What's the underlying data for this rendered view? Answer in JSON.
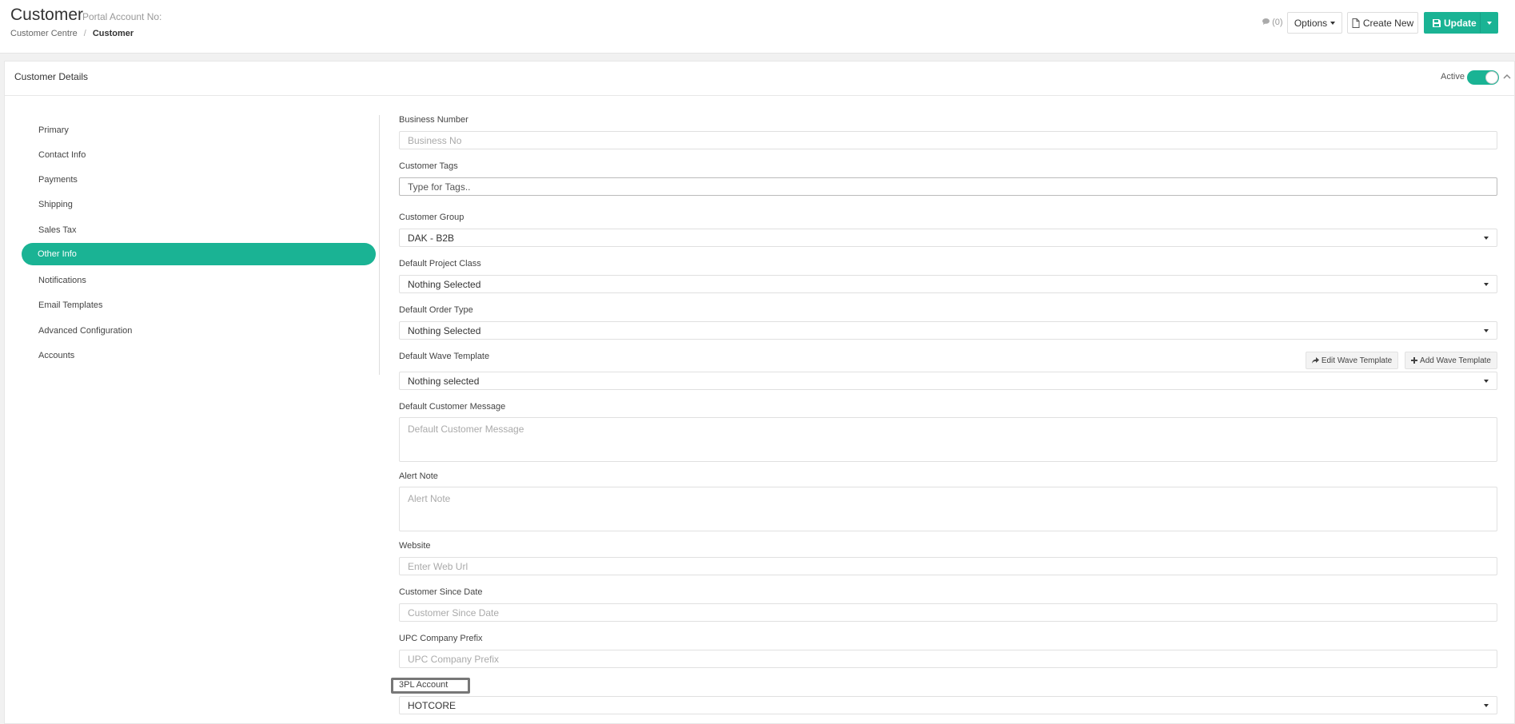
{
  "header": {
    "title": "Customer",
    "portal_label": "Portal Account No:",
    "breadcrumb": [
      "Customer Centre",
      "Customer"
    ],
    "breadcrumb_sep": "/",
    "comments": "(0)",
    "options_label": "Options",
    "create_new_label": "Create New",
    "update_label": "Update"
  },
  "panel": {
    "title": "Customer Details",
    "active_label": "Active",
    "active": true
  },
  "nav": {
    "items": [
      "Primary",
      "Contact Info",
      "Payments",
      "Shipping",
      "Sales Tax",
      "Other Info",
      "Notifications",
      "Email Templates",
      "Advanced Configuration",
      "Accounts"
    ],
    "active": "Other Info"
  },
  "form": {
    "business_number": {
      "label": "Business Number",
      "placeholder": "Business No"
    },
    "customer_tags": {
      "label": "Customer Tags",
      "placeholder": "Type for Tags.."
    },
    "customer_group": {
      "label": "Customer Group",
      "value": "DAK - B2B"
    },
    "default_project_class": {
      "label": "Default Project Class",
      "value": "Nothing Selected"
    },
    "default_order_type": {
      "label": "Default Order Type",
      "value": "Nothing Selected"
    },
    "default_wave_template": {
      "label": "Default Wave Template",
      "value": "Nothing selected",
      "edit_label": "Edit Wave Template",
      "add_label": "Add Wave Template"
    },
    "default_customer_message": {
      "label": "Default Customer Message",
      "placeholder": "Default Customer Message"
    },
    "alert_note": {
      "label": "Alert Note",
      "placeholder": "Alert Note"
    },
    "website": {
      "label": "Website",
      "placeholder": "Enter Web Url"
    },
    "customer_since_date": {
      "label": "Customer Since Date",
      "placeholder": "Customer Since Date"
    },
    "upc_company_prefix": {
      "label": "UPC Company Prefix",
      "placeholder": "UPC Company Prefix"
    },
    "three_pl_account": {
      "label": "3PL Account",
      "value": "HOTCORE"
    }
  },
  "icons": {
    "comment": "comment-icon",
    "file": "file-icon",
    "save": "save-icon",
    "share": "share-icon",
    "plus": "plus-icon",
    "chevron_up": "chevron-up-icon"
  },
  "colors": {
    "accent": "#1ab394",
    "highlight_border": "#777777"
  }
}
